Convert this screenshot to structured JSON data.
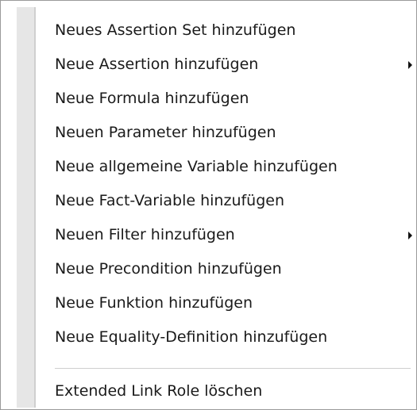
{
  "menu": {
    "items": [
      {
        "label": "Neues Assertion Set hinzufügen",
        "submenu": false
      },
      {
        "label": "Neue Assertion hinzufügen",
        "submenu": true
      },
      {
        "label": "Neue Formula hinzufügen",
        "submenu": false
      },
      {
        "label": "Neuen Parameter hinzufügen",
        "submenu": false
      },
      {
        "label": "Neue allgemeine Variable hinzufügen",
        "submenu": false
      },
      {
        "label": "Neue Fact-Variable hinzufügen",
        "submenu": false
      },
      {
        "label": "Neuen Filter hinzufügen",
        "submenu": true
      },
      {
        "label": "Neue Precondition hinzufügen",
        "submenu": false
      },
      {
        "label": "Neue Funktion hinzufügen",
        "submenu": false
      },
      {
        "label": "Neue Equality-Definition hinzufügen",
        "submenu": false
      }
    ],
    "footer_item": {
      "label": "Extended Link Role löschen"
    },
    "submenu_arrow_icon": "chevron-right-icon"
  }
}
